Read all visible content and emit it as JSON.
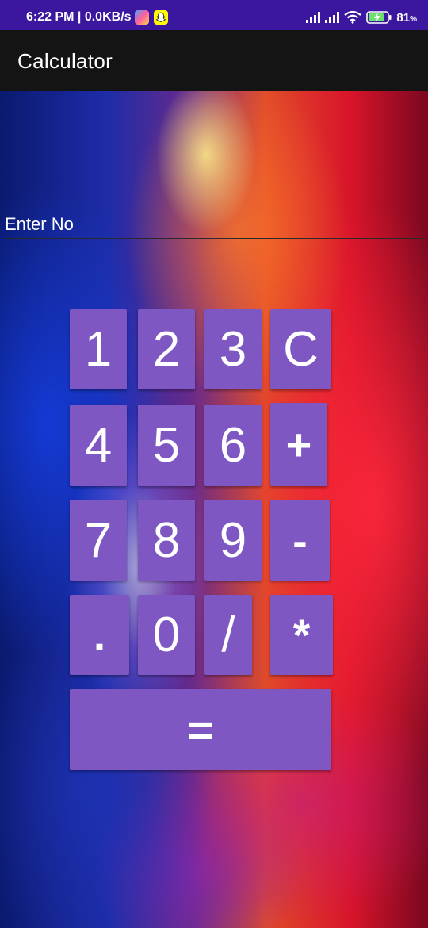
{
  "status_bar": {
    "time_net": "6:22 PM | 0.0KB/s",
    "battery": "81",
    "battery_unit": "%",
    "icons": [
      "gallery-icon",
      "snapchat-icon",
      "signal-icon",
      "signal-icon",
      "wifi-icon",
      "battery-charging-icon"
    ],
    "color": "#3b17a0"
  },
  "toolbar": {
    "title": "Calculator",
    "color": "#141414"
  },
  "input": {
    "placeholder": "Enter No"
  },
  "keypad": {
    "color": "#7e57c2",
    "keys": {
      "one": "1",
      "two": "2",
      "three": "3",
      "clear": "C",
      "four": "4",
      "five": "5",
      "six": "6",
      "plus": "+",
      "seven": "7",
      "eight": "8",
      "nine": "9",
      "minus": "-",
      "dot": ".",
      "zero": "0",
      "divide": "/",
      "multiply": "*",
      "equals": "="
    }
  }
}
